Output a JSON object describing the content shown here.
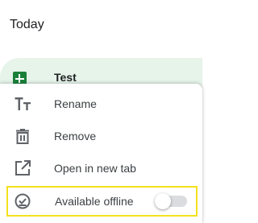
{
  "section": {
    "heading": "Today"
  },
  "file": {
    "name": "Test",
    "icon": "google-sheets-icon",
    "icon_color": "#188038",
    "row_highlight_color": "#e6f4ea"
  },
  "context_menu": {
    "items": [
      {
        "label": "Rename",
        "icon": "text-format-icon"
      },
      {
        "label": "Remove",
        "icon": "trash-icon"
      },
      {
        "label": "Open in new tab",
        "icon": "open-in-new-icon"
      },
      {
        "label": "Available offline",
        "icon": "offline-pin-icon"
      }
    ],
    "offline_toggle": {
      "enabled": false
    },
    "highlight_color": "#f4e11b"
  }
}
